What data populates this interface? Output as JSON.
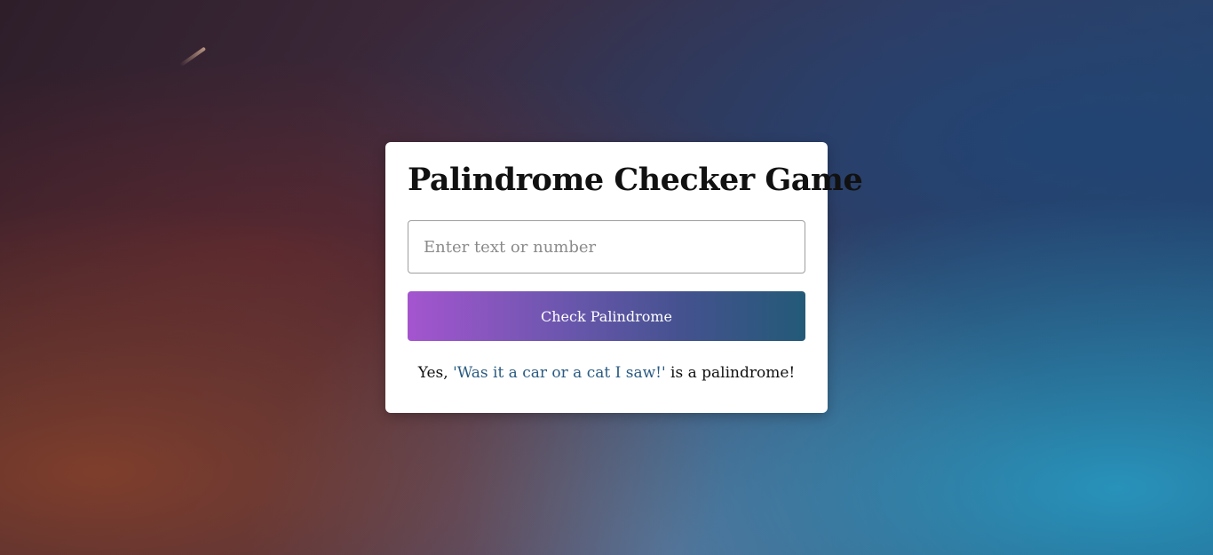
{
  "game": {
    "title": "Palindrome Checker Game",
    "input": {
      "value": "",
      "placeholder": "Enter text or number"
    },
    "check_button_label": "Check Palindrome",
    "result": {
      "prefix": "Yes, ",
      "checked_text": "'Was it a car or a cat I saw!'",
      "suffix": " is a palindrome!"
    }
  },
  "colors": {
    "button_gradient_start": "#a455cf",
    "button_gradient_end": "#235a78",
    "result_highlight": "#2a5b82",
    "card_background": "#ffffff"
  }
}
